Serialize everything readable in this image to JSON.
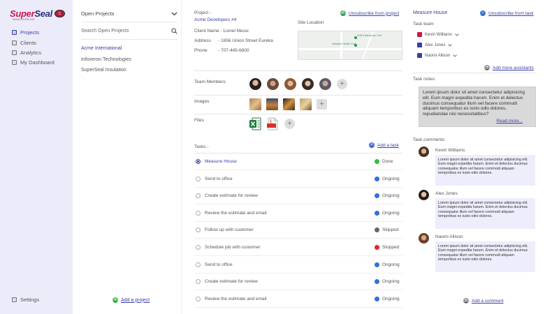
{
  "brand": {
    "name_part1": "Super",
    "name_part2": "Seal",
    "subtitle": "INSULATION INC",
    "badge": "C"
  },
  "nav": {
    "items": [
      {
        "label": "Projects",
        "icon": "folder-icon",
        "active": true
      },
      {
        "label": "Clients",
        "icon": "clients-icon",
        "active": false
      },
      {
        "label": "Analytics",
        "icon": "analytics-icon",
        "active": false
      },
      {
        "label": "My Dashboard",
        "icon": "dashboard-icon",
        "active": false
      }
    ],
    "settings_label": "Settings"
  },
  "projects": {
    "dropdown_label": "Open Projects",
    "search_placeholder": "Search Open Projects",
    "items": [
      {
        "label": "Acme International",
        "active": true
      },
      {
        "label": "Infoxeron Technologies",
        "active": false
      },
      {
        "label": "SuperSeal Insulation",
        "active": false
      }
    ],
    "add_label": "Add a project"
  },
  "project": {
    "label": "Project -",
    "name": "Acme Developers #4",
    "unsubscribe_label": "Unsubscribe from project",
    "client_label": "Client Name -",
    "client_name": "Lionel Messi",
    "address_label": "Address",
    "address_value": "1656 Union Street Eureka",
    "phone_label": "Phone",
    "phone_value": "707-445-6600",
    "site_location_label": "Site Location",
    "map_place1": "Griff's Barbecue Grill",
    "map_place2": "Lifestyle Health Club",
    "team_label": "Team Members",
    "images_label": "Images",
    "files_label": "Files",
    "tasks_label": "Tasks -",
    "add_task_label": "Add a task",
    "tasks": [
      {
        "name": "Measure House",
        "status": "Done",
        "color": "#2fbf4a",
        "active": true
      },
      {
        "name": "Send to office",
        "status": "Ongoing",
        "color": "#2f6fe0",
        "active": false
      },
      {
        "name": "Create estimate for review",
        "status": "Ongoing",
        "color": "#2f6fe0",
        "active": false
      },
      {
        "name": "Review the estimate and email",
        "status": "Ongoing",
        "color": "#2f6fe0",
        "active": false
      },
      {
        "name": "Follow up with customer",
        "status": "Skipped",
        "color": "#666666",
        "active": false
      },
      {
        "name": "Schedule job with customer",
        "status": "Stopped",
        "color": "#e0262f",
        "active": false
      },
      {
        "name": "Send to office",
        "status": "Ongoing",
        "color": "#2f6fe0",
        "active": false
      },
      {
        "name": "Create estimate for review",
        "status": "Ongoing",
        "color": "#2f6fe0",
        "active": false
      },
      {
        "name": "Review the estimate and email",
        "status": "Ongoing",
        "color": "#2f6fe0",
        "active": false
      }
    ]
  },
  "task": {
    "title": "Measure House",
    "unsubscribe_label": "Unsubscribe from task",
    "team_label": "Task team",
    "members": [
      {
        "name": "Kevin Williams",
        "color": "#d0134f"
      },
      {
        "name": "Alex Jones",
        "color": "#3b3fa0"
      },
      {
        "name": "Naomi Allison",
        "color": "#3b3fa0"
      }
    ],
    "add_assistants_label": "Add more assistants",
    "notes_label": "Task notes",
    "notes_text": "Lorem ipsum dolor sit amet consectetur adipisicing elit. Eum magni expedita harum. Enim et delectus ducimus consequatur illum vel facere commodi aliquam temporibus ex iusto odio dolores, repudiandae nisi necessitatibus?",
    "read_more_label": "Read more...",
    "comments_label": "Task comments",
    "comments": [
      {
        "author": "Kevin Williams",
        "text": "Lorem ipsum dolor sit amet consectetur adipisicing elit. Eum magni expedita harum. Enim et delectus ducimus consequatur illum vel facere commodi aliquam temporibus ex iusto odio dolores."
      },
      {
        "author": "Alex Jones",
        "text": "Lorem ipsum dolor sit amet consectetur adipisicing elit. Eum magni expedita harum. Enim et delectus ducimus consequatur illum vel facere commodi aliquam temporibus ex iusto odio dolores."
      },
      {
        "author": "Naomi Allison",
        "text": "Lorem ipsum dolor sit amet consectetur adipisicing elit. Eum magni expedita harum. Enim et delectus ducimus consequatur illum vel facere commodi aliquam temporibus ex iusto odio dolores."
      }
    ],
    "add_comment_label": "Add a comment"
  }
}
